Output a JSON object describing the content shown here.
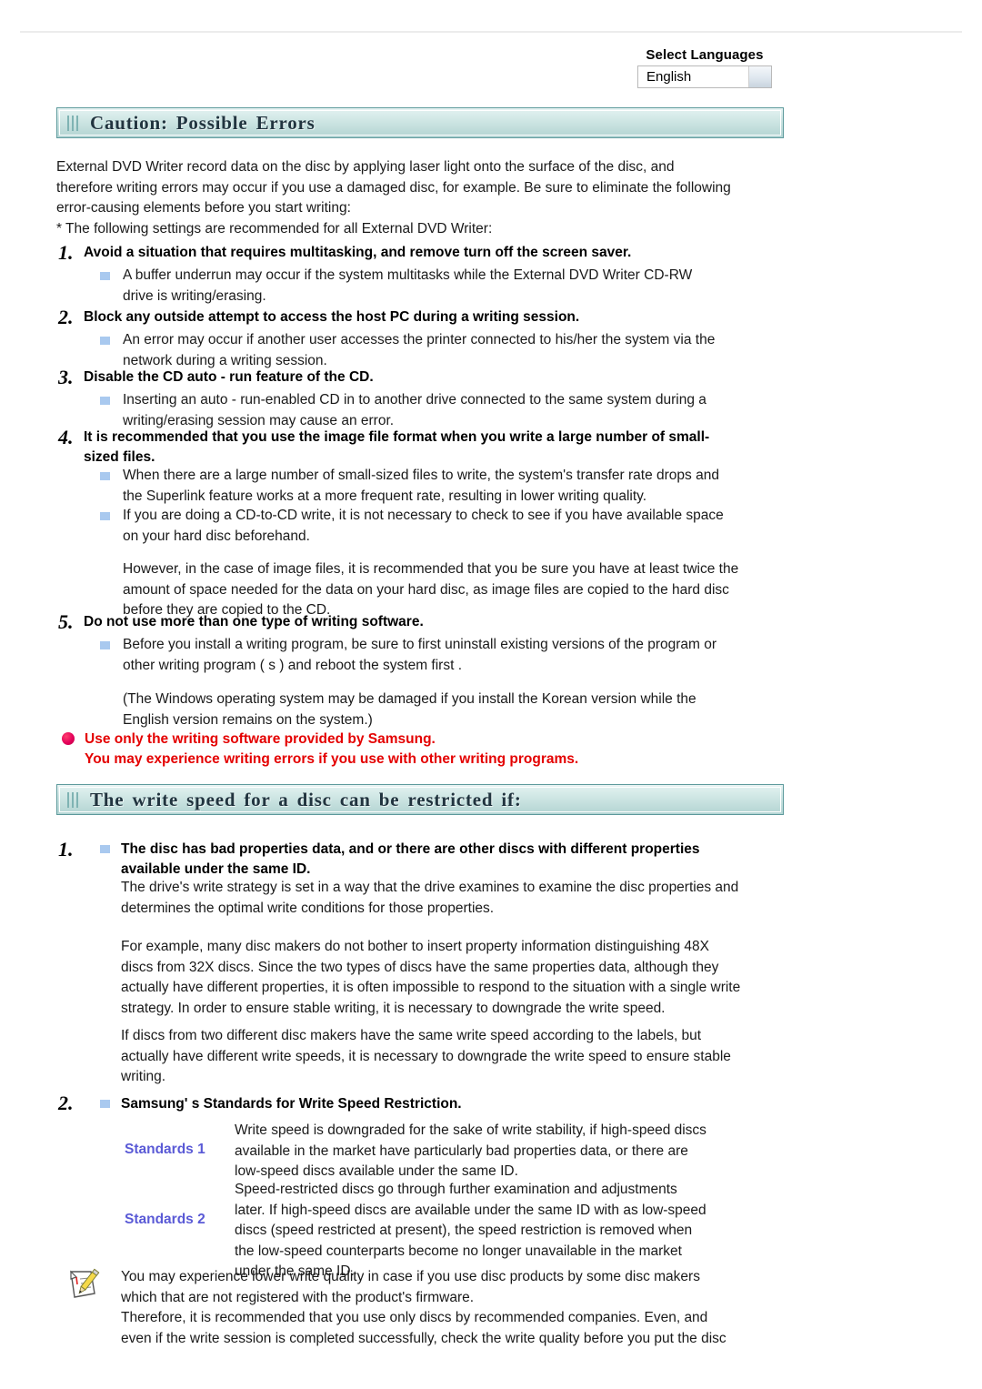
{
  "language": {
    "title": "Select Languages",
    "selected": "English",
    "arrow_glyph": ""
  },
  "sections": [
    {
      "id": "caution",
      "heading": "Caution: Possible Errors",
      "intro": [
        "External DVD Writer record data on the disc by applying laser light onto the surface of the disc, and",
        "therefore writing errors may occur if you use a damaged disc, for example. Be sure to eliminate the following",
        "error-causing elements before you start writing:",
        "* The following settings are recommended for all External DVD Writer:"
      ],
      "items": [
        {
          "number": "1.",
          "heading": [
            "Avoid a situation that requires multitasking, and remove turn off the screen saver."
          ],
          "bullets": [
            [
              "A buffer underrun may occur if the system multitasks while the External DVD Writer CD-RW",
              "drive is writing/erasing."
            ]
          ]
        },
        {
          "number": "2.",
          "heading": [
            "Block any outside attempt to access the host PC during a writing session."
          ],
          "bullets": [
            [
              "An error may occur if another user accesses the printer connected to his/her the system via the",
              "network during a writing session."
            ]
          ]
        },
        {
          "number": "3.",
          "heading": [
            "Disable the CD auto - run feature of the CD."
          ],
          "bullets": [
            [
              "Inserting an auto - run-enabled CD in to another drive connected to the same system during a",
              "writing/erasing session may cause an error."
            ]
          ]
        },
        {
          "number": "4.",
          "heading": [
            "It is recommended that you use the image file format when you write a large number of small-",
            "sized files."
          ],
          "bullets": [
            [
              "When there are a large number of small-sized files to write, the system's transfer rate drops and",
              "the Superlink feature works at a more frequent rate, resulting in lower writing quality."
            ],
            [
              "If you are doing a CD-to-CD write, it is not necessary to check to see if you have available space",
              "on your hard disc beforehand."
            ]
          ],
          "note": [
            "However, in the case of image files, it is recommended that you be sure you have at least twice the",
            "amount of space needed for the data on your hard disc, as image files are copied to the hard disc",
            "before they are copied to the CD."
          ]
        },
        {
          "number": "5.",
          "heading": [
            "Do not use more than one type of writing software."
          ],
          "bullets": [
            [
              "Before you install a writing program, be sure to first uninstall existing versions of the program or",
              "other writing program ( s ) and reboot the system first ."
            ]
          ],
          "note": [
            "(The Windows operating system may be damaged if you install the Korean version while the",
            "English version remains on the system.)"
          ]
        }
      ],
      "warning": [
        "Use only the writing software provided by Samsung.",
        "You may experience writing errors if you use with other writing programs."
      ]
    },
    {
      "id": "write-speed",
      "heading": "The write speed for a disc can be restricted if:",
      "items": [
        {
          "number": "1.",
          "heading": [
            "The disc has bad properties data, and or there are other discs with different properties",
            "available under the same ID."
          ],
          "paragraphs": [
            [
              "The drive's write strategy is set in a way that the drive examines to examine the disc properties and",
              "determines the optimal write conditions for those properties."
            ],
            [
              "For example, many disc makers do not bother to insert property information distinguishing 48X",
              "discs from 32X discs. Since the two types of discs have the same properties data, although they",
              "actually have different properties, it is often impossible to respond to the situation with a single write",
              "strategy. In order to ensure stable writing, it is necessary to downgrade the write speed."
            ],
            [
              "If discs from two different disc makers have the same write speed according to the labels, but",
              "actually have different write speeds, it is necessary to downgrade the write speed to ensure stable",
              "writing."
            ]
          ]
        },
        {
          "number": "2.",
          "heading": [
            "Samsung' s Standards for Write Speed Restriction."
          ],
          "standards": [
            {
              "label": "Standards 1",
              "lines": [
                "Write speed is downgraded for the sake of write stability, if high-speed discs",
                "available in the market have particularly bad properties data, or there are",
                "low-speed discs available under the same ID."
              ]
            },
            {
              "label": "Standards 2",
              "lines": [
                "Speed-restricted discs go through further examination and adjustments",
                "later. If high-speed discs are available under the same ID with as low-speed",
                "discs (speed restricted at present), the speed restriction is removed when",
                "the low-speed counterparts become no longer unavailable in the market",
                "under the same ID."
              ]
            }
          ]
        }
      ],
      "footnote": [
        "You may experience lower write quality in case if you use disc products by some disc makers",
        "which that are not registered with the product's firmware.",
        "Therefore, it is recommended that you use only discs by recommended companies. Even, and",
        "even if the write session is completed successfully, check the write quality before you put the disc"
      ]
    }
  ],
  "colors": {
    "header_border": "#5d9a9c",
    "header_fill": "#b7d7d5",
    "bullet_square": "#a9c9ef",
    "warning_red": "#e40000",
    "standards_blue": "#5a5ad6"
  }
}
